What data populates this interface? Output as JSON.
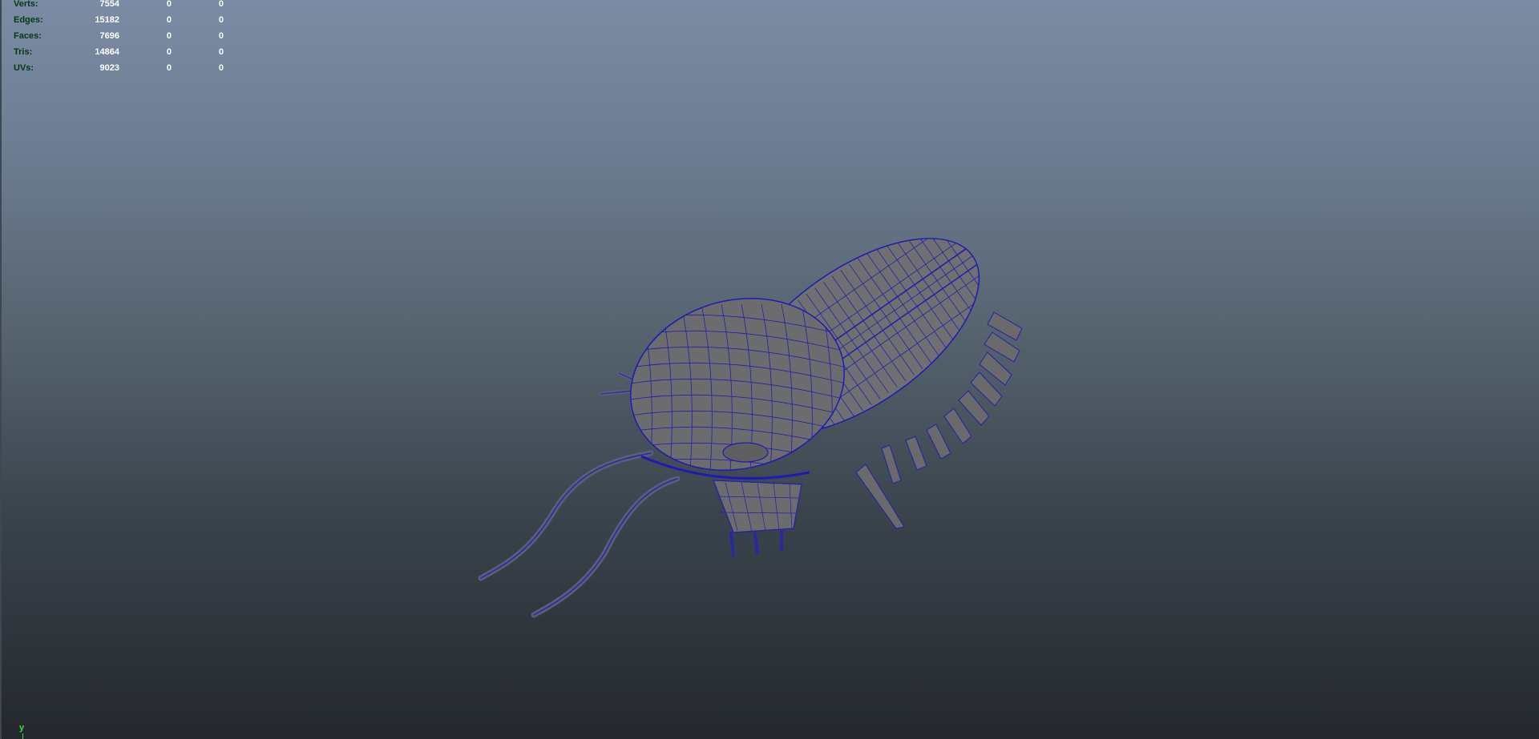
{
  "hud": {
    "rows": [
      {
        "label": "Verts:",
        "values": [
          "7554",
          "0",
          "0"
        ]
      },
      {
        "label": "Edges:",
        "values": [
          "15182",
          "0",
          "0"
        ]
      },
      {
        "label": "Faces:",
        "values": [
          "7696",
          "0",
          "0"
        ]
      },
      {
        "label": "Tris:",
        "values": [
          "14864",
          "0",
          "0"
        ]
      },
      {
        "label": "UVs:",
        "values": [
          "9023",
          "0",
          "0"
        ]
      }
    ]
  },
  "axis": {
    "label": "y"
  },
  "colors": {
    "wireframe": "#1f1ab4",
    "mesh_fill": "#6e6e6e",
    "hud_label": "#003a14",
    "hud_value": "#ffffff",
    "axis": "#3adb3a"
  },
  "model": {
    "icon": "trilobite-wireframe-mesh"
  }
}
